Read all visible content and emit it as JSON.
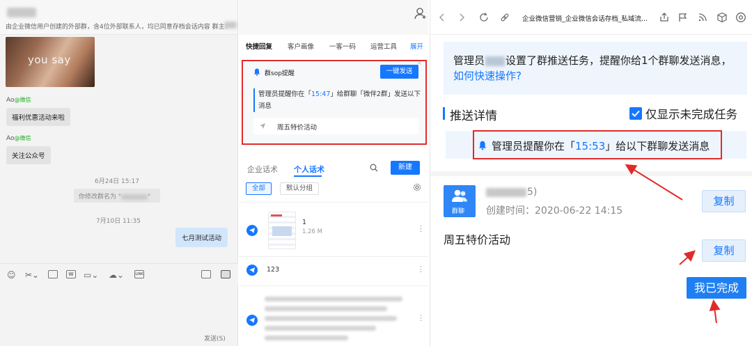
{
  "chat": {
    "subtitle": "由企业微信用户创建的外部群，含4位外部联系人，均已同意存档会话内容  群主：",
    "photo_caption": "you say",
    "sender_name": "Ao",
    "sender_tag": "@微信",
    "msg1": "福利优惠活动来啦",
    "msg2": "关注公众号",
    "time1": "6月24日 15:17",
    "rename_note_prefix": "你修改群名为 \"",
    "rename_note_suffix": "\"",
    "time2": "7月10日 11:35",
    "my_msg": "七月测试活动",
    "send_label": "发送(S)"
  },
  "side": {
    "tabs": [
      "快捷回复",
      "客户画像",
      "一客一码",
      "运营工具"
    ],
    "more": "展开",
    "sop_title": "群sop提醒",
    "sop_btn": "一键发送",
    "sop_msg_a": "管理员提醒你在「",
    "sop_time": "15:47",
    "sop_msg_b": "」给群聊「微伴2群」发送以下消息",
    "sop_item": "周五特价活动",
    "script_tab_company": "企业话术",
    "script_tab_personal": "个人话术",
    "new_btn": "新建",
    "chip_all": "全部",
    "chip_default": "默认分组",
    "file_name": "1",
    "file_size": "1.26 M",
    "text_row": "123"
  },
  "mobile": {
    "title": "企业微信营销_企业微信会话存档_私域流...",
    "notice_a": "管理员",
    "notice_b": "设置了群推送任务，提醒你给1个群聊发送消息，",
    "notice_link": "如何快速操作?",
    "push_title": "推送详情",
    "only_unfinished": "仅显示未完成任务",
    "remind_a": "管理员提醒你在「",
    "remind_time": "15:53",
    "remind_b": "」给以下群聊发送消息",
    "group_label": "群聊",
    "group_count": "5)",
    "created": "创建时间：2020-06-22 14:15",
    "copy": "复制",
    "content": "周五特价活动",
    "done": "我已完成"
  },
  "colors": {
    "accent": "#1677ff",
    "highlight": "#e02a2a"
  }
}
